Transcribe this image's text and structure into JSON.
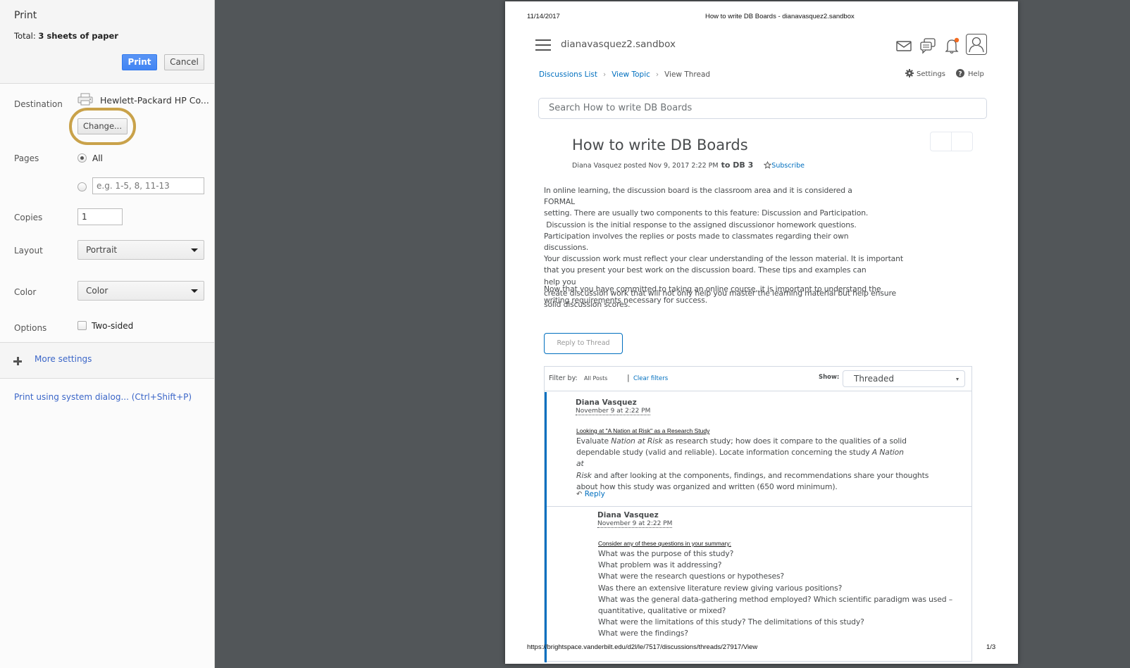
{
  "print_dialog": {
    "title": "Print",
    "total_prefix": "Total: ",
    "total_value": "3 sheets of paper",
    "print_label": "Print",
    "cancel_label": "Cancel",
    "destination": {
      "label": "Destination",
      "printer_name": "Hewlett-Packard HP Co...",
      "change_label": "Change..."
    },
    "pages": {
      "label": "Pages",
      "all_label": "All",
      "selected": "All",
      "range_placeholder": "e.g. 1-5, 8, 11-13"
    },
    "copies": {
      "label": "Copies",
      "value": "1"
    },
    "layout": {
      "label": "Layout",
      "value": "Portrait"
    },
    "color": {
      "label": "Color",
      "value": "Color"
    },
    "options": {
      "label": "Options",
      "two_sided_label": "Two-sided",
      "two_sided_checked": false
    },
    "more_settings_label": "More settings",
    "system_dialog_label": "Print using system dialog... (Ctrl+Shift+P)",
    "accent_color": "#4285f4",
    "highlight_color": "#c9a24a"
  },
  "preview": {
    "header_date": "11/14/2017",
    "header_title": "How to write DB Boards - dianavasquez2.sandbox",
    "footer_url": "https://brightspace.vanderbilt.edu/d2l/le/7517/discussions/threads/27917/View",
    "footer_page": "1/3",
    "org_name": "dianavasquez2.sandbox",
    "breadcrumb": {
      "items": [
        "Discussions List",
        "View Topic",
        "View Thread"
      ]
    },
    "settings_label": "Settings",
    "help_label": "Help",
    "search_placeholder": "Search How to write DB Boards",
    "topic": {
      "title": "How to write DB Boards",
      "meta": "Diana Vasquez posted Nov 9, 2017 2:22 PM",
      "to_label": "to DB 3",
      "subscribe_label": "Subscribe"
    },
    "intro_lines": [
      "In online learning, the discussion board is the classroom area and it is considered a FORMAL",
      "setting. There are usually two components to this feature: Discussion and Participation.",
      " Discussion is the initial response to the assigned discussionor homework questions.",
      "Participation involves the replies or posts made to classmates regarding their own discussions.",
      "Your discussion work must reflect your clear understanding of the lesson material. It is important",
      "that you present your best work on the discussion board. These tips and examples can help you",
      "create discussion work that will not only help you master the learning material but help ensure",
      "solid discussion scores."
    ],
    "intro_para2_lines": [
      "Now that you have committed to taking an online course, it is important to understand the",
      "writing requirements necessary for success."
    ],
    "reply_thread_label": "Reply to Thread",
    "filter": {
      "label": "Filter by:",
      "value": "All Posts",
      "clear_label": "Clear filters",
      "show_label": "Show:",
      "show_value": "Threaded"
    },
    "posts": [
      {
        "author": "Diana Vasquez",
        "date": "November 9 at 2:22 PM",
        "subject": "Looking at \"A Nation at Risk\" as a Research Study",
        "body_lines": [
          "Evaluate Nation at Risk as research study; how does it compare to the qualities of a solid",
          "dependable study (valid and reliable). Locate information concerning the study A Nation at",
          "Risk and after looking at the components, findings, and recommendations share your thoughts",
          "about how this study was organized and written (650 word minimum)."
        ],
        "reply_label": "Reply"
      },
      {
        "author": "Diana Vasquez",
        "date": "November 9 at 2:22 PM",
        "subject": "Consider any of these questions in your summary:",
        "body_lines": [
          "What was the purpose of this study?",
          "What problem was it addressing?",
          "What were the research questions or hypotheses?",
          "Was there an extensive literature review giving various positions?",
          "What was the general data-gathering method employed? Which scientific paradigm was used –",
          "quantitative, qualitative or mixed?",
          "What were the limitations of this study? The delimitations of this study?",
          "What were the findings?"
        ]
      }
    ],
    "link_color": "#006fbf",
    "notification_dot_color": "#f26b21"
  }
}
